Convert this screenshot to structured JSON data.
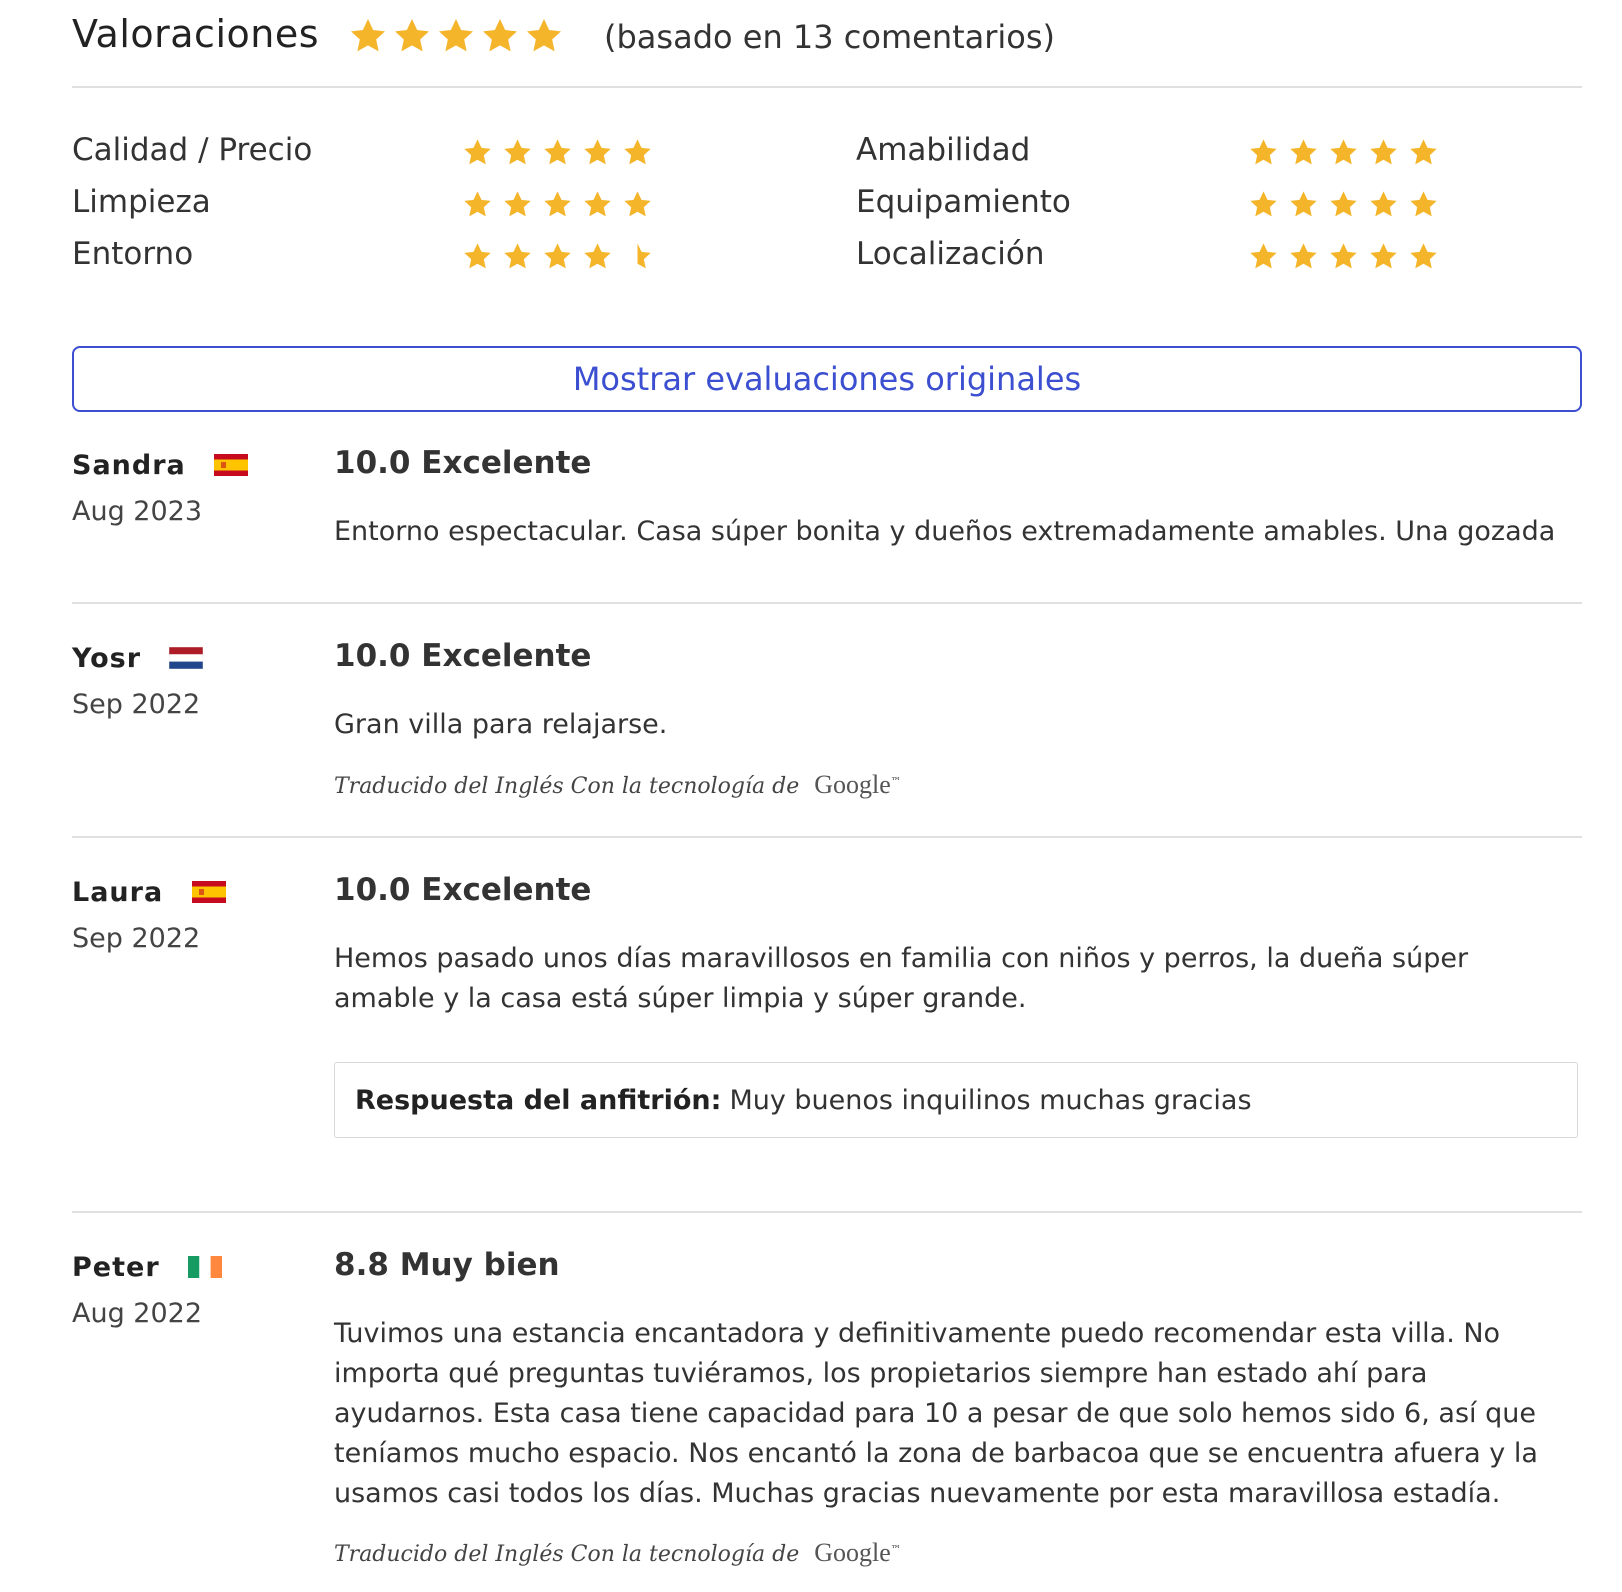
{
  "header": {
    "title": "Valoraciones",
    "overall_stars": 5,
    "count_text": "(basado en 13 comentarios)"
  },
  "colors": {
    "star": "#f5b52b",
    "accent": "#3b4fd0",
    "rule": "#e0e0e0"
  },
  "categories": [
    {
      "label": "Calidad / Precio",
      "stars": 5
    },
    {
      "label": "Amabilidad",
      "stars": 5
    },
    {
      "label": "Limpieza",
      "stars": 5
    },
    {
      "label": "Equipamiento",
      "stars": 5
    },
    {
      "label": "Entorno",
      "stars": 4.5
    },
    {
      "label": "Localización",
      "stars": 5
    }
  ],
  "show_original_label": "Mostrar evaluaciones originales",
  "reviews": [
    {
      "name": "Sandra",
      "flag": "spain-flag-icon",
      "date": "Aug 2023",
      "score": "10.0 Excelente",
      "text": "Entorno espectacular. Casa súper bonita y dueños extremadamente amables. Una gozada"
    },
    {
      "name": "Yosr",
      "flag": "netherlands-flag-icon",
      "date": "Sep 2022",
      "score": "10.0 Excelente",
      "text": "Gran villa para relajarse.",
      "translated": "Traducido del Inglés Con la tecnología de",
      "google": "Google"
    },
    {
      "name": "Laura",
      "flag": "spain-flag-icon",
      "date": "Sep 2022",
      "score": "10.0 Excelente",
      "text": "Hemos pasado unos días maravillosos en familia con niños y perros, la dueña súper amable y la casa está súper limpia y súper grande.",
      "host_label": "Respuesta del anfitrión:",
      "host_text": "Muy buenos inquilinos muchas gracias"
    },
    {
      "name": "Peter",
      "flag": "ireland-flag-icon",
      "date": "Aug 2022",
      "score": "8.8 Muy bien",
      "text": "Tuvimos una estancia encantadora y definitivamente puedo recomendar esta villa. No importa qué preguntas tuviéramos, los propietarios siempre han estado ahí para ayudarnos. Esta casa tiene capacidad para 10 a pesar de que solo hemos sido 6, así que teníamos mucho espacio. Nos encantó la zona de barbacoa que se encuentra afuera y la usamos casi todos los días. Muchas gracias nuevamente por esta maravillosa estadía.",
      "translated": "Traducido del Inglés Con la tecnología de",
      "google": "Google"
    }
  ]
}
